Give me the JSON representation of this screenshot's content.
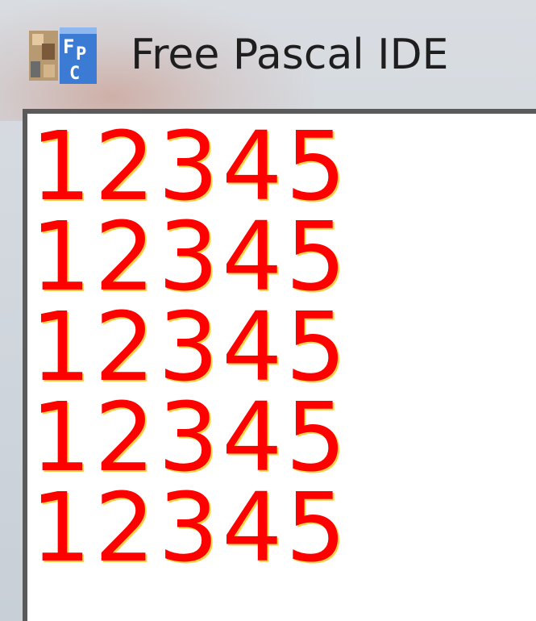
{
  "window": {
    "title": "Free Pascal IDE",
    "icon": "free-pascal-app-icon",
    "text_color": "#ff0000"
  },
  "console": {
    "lines": [
      "12345",
      "12345",
      "12345",
      "12345",
      "12345"
    ]
  }
}
